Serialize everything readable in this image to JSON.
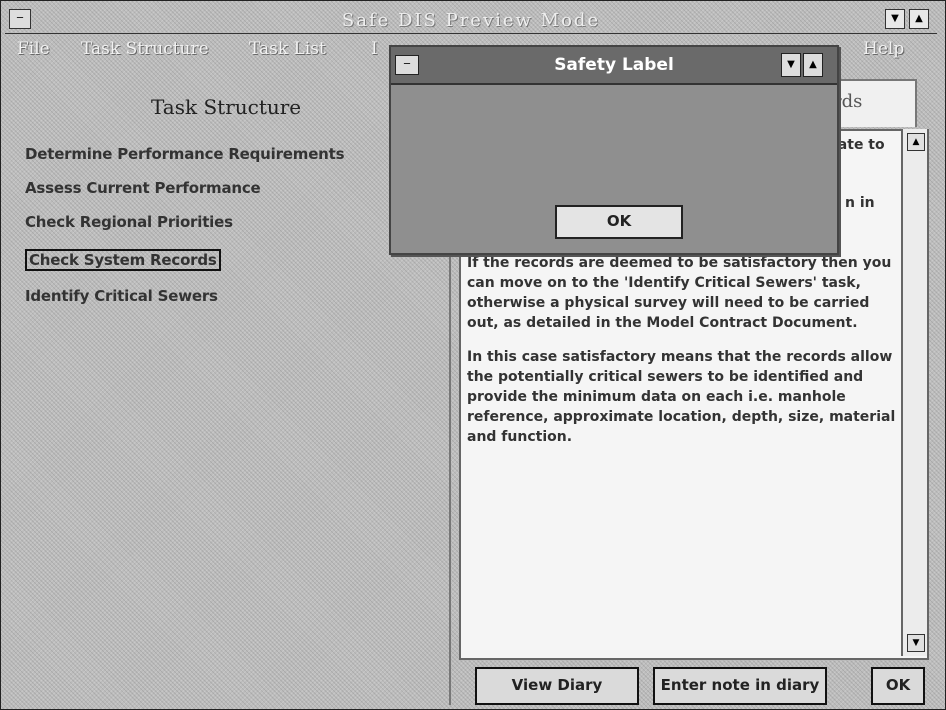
{
  "window": {
    "title": "Safe DIS   Preview Mode"
  },
  "menu": {
    "items": [
      "File",
      "Task Structure",
      "Task List",
      "I"
    ],
    "help": "Help"
  },
  "left": {
    "heading": "Task Structure",
    "tasks": [
      "Determine Performance Requirements",
      "Assess Current Performance",
      "Check Regional Priorities",
      "Check System Records",
      "Identify Critical Sewers"
    ],
    "selected_index": 3
  },
  "right": {
    "tab_partial": "rds",
    "snippet_top": "late to",
    "snippet_mid": "n in",
    "paragraphs": [
      "If the records are deemed to be satisfactory then you can move on to the 'Identify Critical Sewers' task, otherwise a physical survey will need to be carried out, as detailed in the Model Contract Document.",
      "In this case satisfactory means that the records allow the potentially critical sewers to be identified and provide the minimum data on each i.e. manhole reference, approximate location, depth, size, material and function."
    ]
  },
  "buttons": {
    "view_diary": "View Diary",
    "enter_note": "Enter note in diary",
    "ok": "OK"
  },
  "dialog": {
    "title": "Safety Label",
    "message": "",
    "ok": "OK"
  }
}
